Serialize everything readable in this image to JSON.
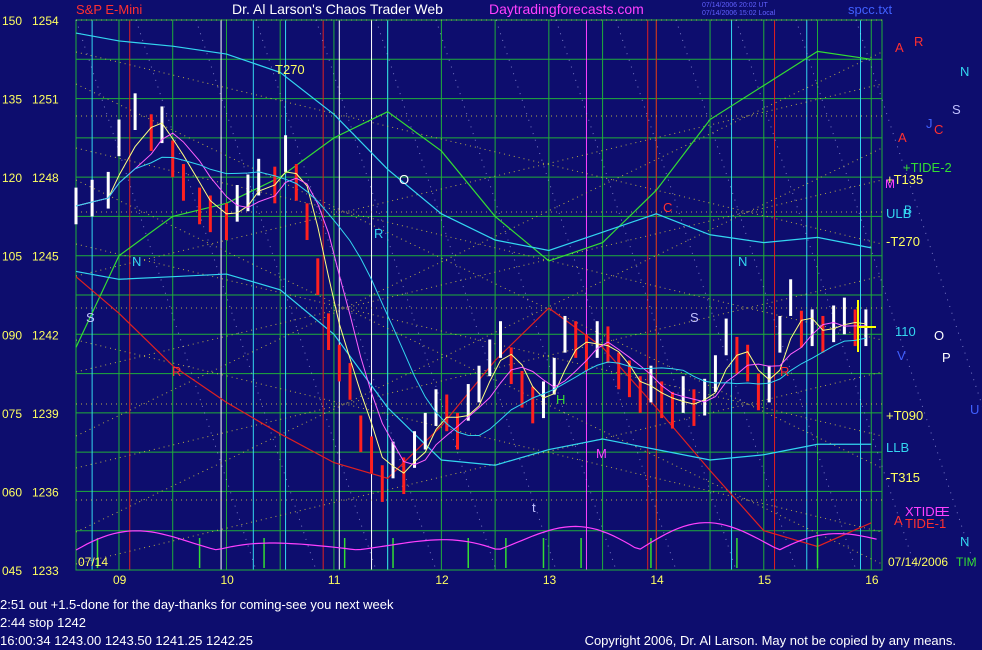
{
  "header": {
    "symbol": "S&P E-Mini",
    "title": "Dr. Al Larson's Chaos Trader Web",
    "site": "Daytradingforecasts.com",
    "timestamp_line1": "07/14/2006 20:02 UT",
    "timestamp_line2": "07/14/2006 15:02 Local",
    "file": "spcc.txt"
  },
  "colors": {
    "background": "#0d0d6e",
    "grid_green": "#1fae3a",
    "candle_up": "#ffffff",
    "candle_down": "#ff2020",
    "cyan": "#33d6f0",
    "green_line": "#33dd33",
    "red_line": "#e02020",
    "magenta": "#ff40ff",
    "yellow": "#ffff00"
  },
  "chart_data": {
    "type": "line",
    "title": "S&P E-Mini",
    "xlabel": "",
    "ylabel": "",
    "x_ticks": [
      "09",
      "10",
      "11",
      "12",
      "13",
      "14",
      "15",
      "16"
    ],
    "date_label": "07/14",
    "date_label_right": "07/14/2006",
    "y_left_labels": [
      "150",
      "135",
      "120",
      "105",
      "090",
      "075",
      "060",
      "045"
    ],
    "y_price_labels": [
      "1254",
      "1251",
      "1248",
      "1245",
      "1242",
      "1239",
      "1236",
      "1233"
    ],
    "ylim": [
      1233,
      1254
    ],
    "xlim": [
      8.6,
      16.1
    ],
    "grid": true,
    "series": [
      {
        "name": "price",
        "x": [
          8.6,
          8.75,
          8.9,
          9.0,
          9.15,
          9.3,
          9.4,
          9.5,
          9.6,
          9.75,
          9.85,
          10.0,
          10.1,
          10.2,
          10.3,
          10.45,
          10.55,
          10.65,
          10.75,
          10.85,
          10.95,
          11.05,
          11.15,
          11.25,
          11.35,
          11.45,
          11.55,
          11.65,
          11.75,
          11.85,
          11.95,
          12.05,
          12.15,
          12.25,
          12.35,
          12.45,
          12.55,
          12.65,
          12.75,
          12.85,
          12.95,
          13.05,
          13.15,
          13.25,
          13.35,
          13.45,
          13.55,
          13.65,
          13.75,
          13.85,
          13.95,
          14.05,
          14.15,
          14.25,
          14.35,
          14.45,
          14.55,
          14.65,
          14.75,
          14.85,
          14.95,
          15.05,
          15.15,
          15.25,
          15.35,
          15.45,
          15.55,
          15.65,
          15.75,
          15.85,
          15.95
        ],
        "y": [
          1246.9,
          1247.2,
          1247.5,
          1249.5,
          1250.5,
          1249.7,
          1250.0,
          1248.7,
          1247.8,
          1246.9,
          1246.6,
          1246.3,
          1247.0,
          1247.4,
          1248.0,
          1247.7,
          1248.9,
          1247.8,
          1246.3,
          1244.2,
          1242.1,
          1240.9,
          1240.2,
          1238.2,
          1237.4,
          1236.3,
          1237.2,
          1236.6,
          1237.6,
          1238.3,
          1239.2,
          1239.0,
          1238.3,
          1239.4,
          1240.1,
          1241.1,
          1241.8,
          1240.8,
          1239.9,
          1239.3,
          1239.5,
          1240.4,
          1242.0,
          1241.8,
          1241.3,
          1241.8,
          1241.6,
          1240.6,
          1240.3,
          1239.7,
          1240.1,
          1239.5,
          1239.1,
          1239.7,
          1239.2,
          1239.6,
          1240.5,
          1241.9,
          1241.2,
          1240.9,
          1239.8,
          1240.1,
          1242.0,
          1243.4,
          1242.2,
          1242.25,
          1242.0,
          1242.4,
          1242.7,
          1242.25,
          1242.25
        ]
      },
      {
        "name": "TIDE-2",
        "x": [
          8.6,
          9.0,
          9.5,
          10.0,
          10.5,
          11.0,
          11.5,
          12.0,
          12.5,
          13.0,
          13.5,
          14.0,
          14.5,
          15.0,
          15.5,
          16.0
        ],
        "y": [
          1241.5,
          1245.0,
          1246.5,
          1247.0,
          1248.0,
          1249.5,
          1250.5,
          1249.0,
          1246.5,
          1244.8,
          1245.5,
          1247.5,
          1250.2,
          1251.5,
          1252.8,
          1252.5
        ]
      },
      {
        "name": "TIDE-1",
        "x": [
          8.6,
          9.0,
          9.5,
          10.0,
          10.5,
          11.0,
          11.5,
          12.0,
          12.5,
          13.0,
          13.5,
          14.0,
          14.5,
          15.0,
          15.5,
          16.0
        ],
        "y": [
          1244.2,
          1242.8,
          1240.8,
          1239.4,
          1238.2,
          1237.1,
          1236.5,
          1238.5,
          1241.0,
          1243.0,
          1241.5,
          1239.2,
          1236.8,
          1234.5,
          1233.9,
          1234.8
        ]
      },
      {
        "name": "ULB",
        "x": [
          8.6,
          9.0,
          9.5,
          10.0,
          10.5,
          11.0,
          11.5,
          12.0,
          12.5,
          13.0,
          13.5,
          14.0,
          14.5,
          15.0,
          15.5,
          16.0
        ],
        "y": [
          1253.5,
          1253.2,
          1253.0,
          1252.7,
          1252.0,
          1250.4,
          1248.3,
          1246.6,
          1245.6,
          1245.2,
          1245.9,
          1246.6,
          1245.8,
          1245.5,
          1245.7,
          1245.3
        ]
      },
      {
        "name": "LLB",
        "x": [
          8.6,
          9.0,
          9.5,
          10.0,
          10.5,
          11.0,
          11.5,
          12.0,
          12.5,
          13.0,
          13.5,
          14.0,
          14.5,
          15.0,
          15.5,
          16.0
        ],
        "y": [
          1244.4,
          1244.1,
          1244.2,
          1244.3,
          1243.7,
          1242.0,
          1239.2,
          1237.2,
          1237.0,
          1237.6,
          1238.0,
          1237.6,
          1237.2,
          1237.4,
          1237.8,
          1237.8
        ]
      }
    ]
  },
  "right_labels": {
    "t135": "+T135",
    "ulb": "ULB",
    "t270": "-T270",
    "v110": "110",
    "t090": "+T090",
    "llb": "LLB",
    "t315": "-T315",
    "tide2": "+TIDE-2",
    "tide1": "TIDE-1",
    "xtide": "XTIDE",
    "t270_top": "T270"
  },
  "markers": {
    "a": "A",
    "r": "R",
    "n": "N",
    "s": "S",
    "c": "C",
    "o": "O",
    "p": "P",
    "v": "V",
    "m": "M",
    "h": "H",
    "t": "t",
    "u": "U",
    "e": "E",
    "j": "J",
    "b": "B",
    "tim": "TIM"
  },
  "footer": {
    "line1": "2:51 out +1.5-done for the day-thanks for coming-see you next week",
    "line2": "2:44 stop 1242",
    "line3": "16:00:34  1243.00  1243.50  1241.25  1242.25",
    "copyright": "Copyright 2006, Dr. Al Larson. May not be copied by any means."
  }
}
